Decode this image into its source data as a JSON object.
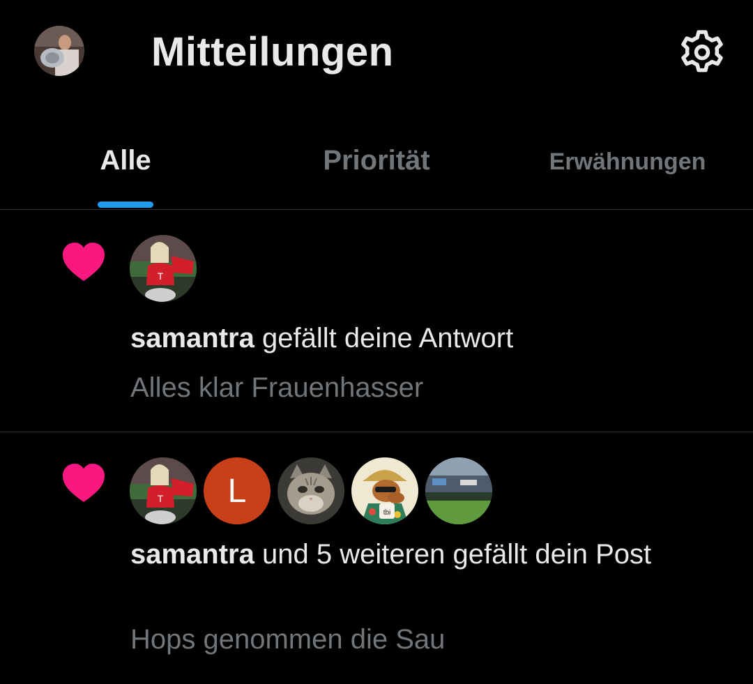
{
  "header": {
    "title": "Mitteilungen",
    "profile_icon": "profile-avatar",
    "settings_icon": "gear-icon"
  },
  "tabs": [
    {
      "label": "Alle",
      "active": true
    },
    {
      "label": "Priorität",
      "active": false
    },
    {
      "label": "Erwähnungen",
      "active": false
    }
  ],
  "colors": {
    "background": "#000000",
    "accent": "#1d9bf0",
    "like": "#f91880",
    "muted_text": "#71767b",
    "primary_text": "#e7e9ea"
  },
  "notifications": [
    {
      "icon": "heart-icon",
      "user": "samantra",
      "action": " gefällt deine Antwort",
      "snippet": "Alles klar Frauenhasser",
      "avatars": [
        "avatar-samantra"
      ]
    },
    {
      "icon": "heart-icon",
      "user": "samantra",
      "action": " und 5 weiteren gefällt dein Post",
      "snippet": "Hops genommen die Sau",
      "avatars": [
        "avatar-samantra",
        "avatar-l",
        "avatar-cat",
        "avatar-camel",
        "avatar-stadium"
      ],
      "letter_avatar": "L"
    }
  ]
}
